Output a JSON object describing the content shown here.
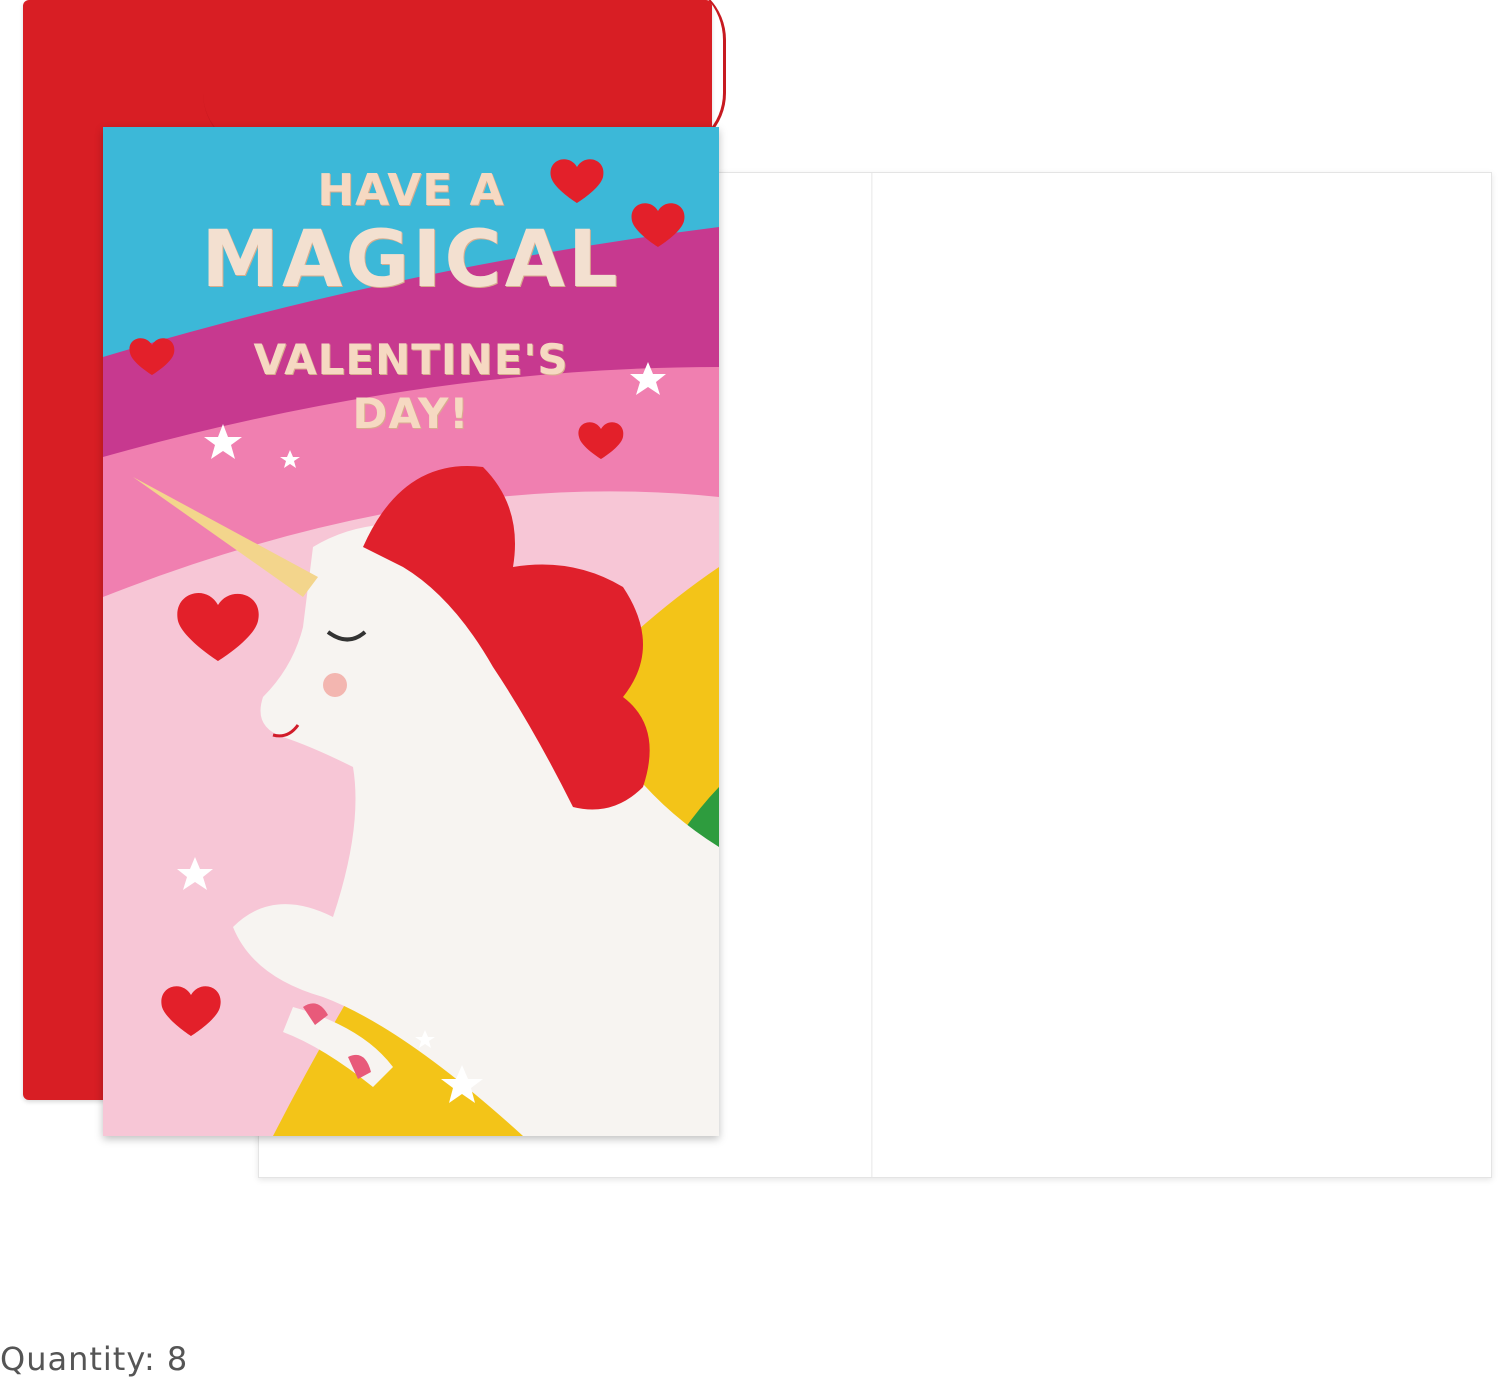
{
  "card": {
    "line1": "HAVE A",
    "line2": "MAGICAL",
    "line3": "VALENTINE'S",
    "line4": "DAY!"
  },
  "quantity_label": "Quantity: 8",
  "colors": {
    "envelope": "#d81e24",
    "sky": "#3cb8d8",
    "band_magenta": "#c7398f",
    "band_pink": "#f07fb0",
    "band_light_pink": "#f7c6d6",
    "band_yellow": "#f3c418",
    "band_green": "#2e9c3e",
    "heart": "#e3202a",
    "mane": "#e0202c"
  }
}
